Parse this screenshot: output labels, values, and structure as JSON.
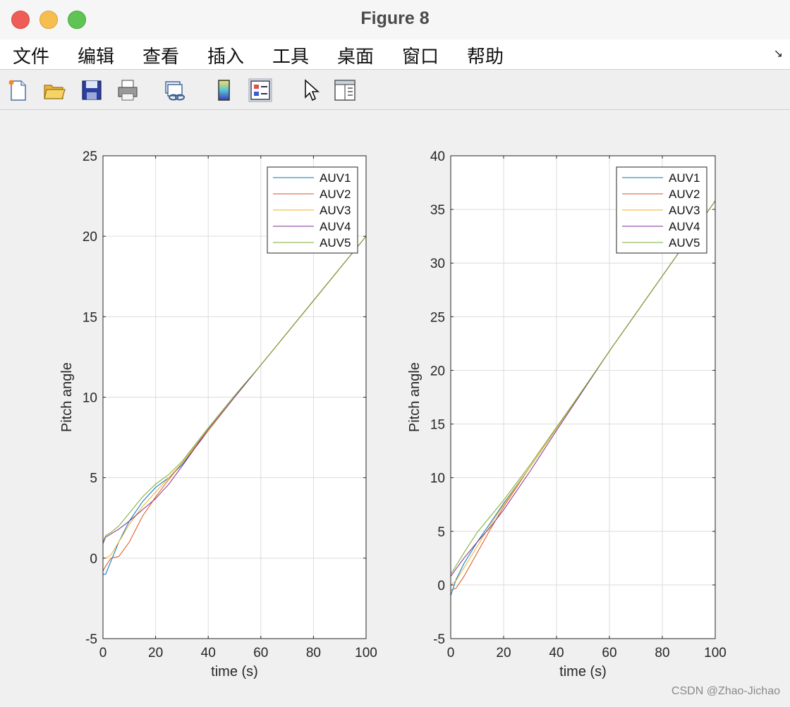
{
  "window": {
    "title": "Figure 8"
  },
  "menu": {
    "items": [
      "文件",
      "编辑",
      "查看",
      "插入",
      "工具",
      "桌面",
      "窗口",
      "帮助"
    ]
  },
  "toolbar": {
    "icons": [
      "new-figure-icon",
      "open-file-icon",
      "save-icon",
      "print-icon",
      "link-plot-icon",
      "colorbar-icon",
      "legend-icon",
      "pointer-icon",
      "property-editor-icon"
    ]
  },
  "watermark": "CSDN @Zhao-Jichao",
  "chart_data": [
    {
      "type": "line",
      "xlabel": "time (s)",
      "ylabel": "Pitch angle",
      "xlim": [
        0,
        100
      ],
      "ylim": [
        -5,
        25
      ],
      "xticks": [
        0,
        20,
        40,
        60,
        80,
        100
      ],
      "yticks": [
        -5,
        0,
        5,
        10,
        15,
        20,
        25
      ],
      "grid": true,
      "legend_position": "top-right",
      "series": [
        {
          "name": "AUV1",
          "color": "#0072bd",
          "x": [
            0,
            1,
            3,
            6,
            10,
            15,
            20,
            25,
            30,
            40,
            50,
            60,
            70,
            80,
            90,
            100
          ],
          "y": [
            -1,
            -1.0,
            -0.2,
            1.0,
            2.3,
            3.5,
            4.4,
            5.0,
            5.8,
            7.9,
            10.0,
            12.0,
            14.0,
            16.0,
            18.0,
            20.0
          ]
        },
        {
          "name": "AUV2",
          "color": "#d95319",
          "x": [
            0,
            1,
            3,
            6,
            10,
            15,
            20,
            25,
            30,
            40,
            50,
            60,
            70,
            80,
            90,
            100
          ],
          "y": [
            -0.8,
            -0.5,
            0,
            0.1,
            1.0,
            2.6,
            3.8,
            4.9,
            5.9,
            8.0,
            10.0,
            12.0,
            14.0,
            16.0,
            18.0,
            20.0
          ]
        },
        {
          "name": "AUV3",
          "color": "#edb120",
          "x": [
            0,
            1,
            3,
            6,
            10,
            15,
            20,
            25,
            30,
            40,
            50,
            60,
            70,
            80,
            90,
            100
          ],
          "y": [
            0,
            0,
            0.2,
            1.0,
            2.1,
            3.2,
            4.1,
            5.0,
            5.9,
            7.9,
            10.0,
            12.0,
            14.0,
            16.0,
            18.0,
            20.0
          ]
        },
        {
          "name": "AUV4",
          "color": "#7e2f8e",
          "x": [
            0,
            1,
            3,
            6,
            10,
            15,
            20,
            25,
            30,
            40,
            50,
            60,
            70,
            80,
            90,
            100
          ],
          "y": [
            0.9,
            1.3,
            1.5,
            1.8,
            2.3,
            3.0,
            3.7,
            4.6,
            5.7,
            8.0,
            10.0,
            12.0,
            14.0,
            16.0,
            18.0,
            20.0
          ]
        },
        {
          "name": "AUV5",
          "color": "#77ac30",
          "x": [
            0,
            1,
            3,
            6,
            10,
            15,
            20,
            25,
            30,
            40,
            50,
            60,
            70,
            80,
            90,
            100
          ],
          "y": [
            1.0,
            1.4,
            1.6,
            2.0,
            2.8,
            3.8,
            4.6,
            5.2,
            6.0,
            8.1,
            10.1,
            12.0,
            14.0,
            16.0,
            18.0,
            20.0
          ]
        }
      ]
    },
    {
      "type": "line",
      "xlabel": "time (s)",
      "ylabel": "Pitch angle",
      "xlim": [
        0,
        100
      ],
      "ylim": [
        -5,
        40
      ],
      "xticks": [
        0,
        20,
        40,
        60,
        80,
        100
      ],
      "yticks": [
        -5,
        0,
        5,
        10,
        15,
        20,
        25,
        30,
        35,
        40
      ],
      "grid": true,
      "legend_position": "top-right",
      "series": [
        {
          "name": "AUV1",
          "color": "#0072bd",
          "x": [
            0,
            2,
            5,
            10,
            15,
            20,
            30,
            40,
            50,
            60,
            70,
            80,
            90,
            100
          ],
          "y": [
            -1,
            0.5,
            2.0,
            4.0,
            5.8,
            7.6,
            11.0,
            14.6,
            18.2,
            21.8,
            25.3,
            28.8,
            32.3,
            35.8
          ]
        },
        {
          "name": "AUV2",
          "color": "#d95319",
          "x": [
            0,
            2,
            5,
            10,
            15,
            20,
            30,
            40,
            50,
            60,
            70,
            80,
            90,
            100
          ],
          "y": [
            -0.5,
            -0.3,
            0.8,
            3.0,
            5.2,
            7.3,
            11.0,
            14.6,
            18.2,
            21.8,
            25.3,
            28.8,
            32.3,
            35.8
          ]
        },
        {
          "name": "AUV3",
          "color": "#edb120",
          "x": [
            0,
            2,
            5,
            10,
            15,
            20,
            30,
            40,
            50,
            60,
            70,
            80,
            90,
            100
          ],
          "y": [
            0,
            0.4,
            1.6,
            3.6,
            5.6,
            7.5,
            11.0,
            14.6,
            18.2,
            21.8,
            25.3,
            28.8,
            32.3,
            35.8
          ]
        },
        {
          "name": "AUV4",
          "color": "#7e2f8e",
          "x": [
            0,
            2,
            5,
            10,
            15,
            20,
            30,
            40,
            50,
            60,
            70,
            80,
            90,
            100
          ],
          "y": [
            0.8,
            1.5,
            2.5,
            4.0,
            5.4,
            7.0,
            10.6,
            14.4,
            18.1,
            21.8,
            25.3,
            28.8,
            32.3,
            35.8
          ]
        },
        {
          "name": "AUV5",
          "color": "#77ac30",
          "x": [
            0,
            2,
            5,
            10,
            15,
            20,
            30,
            40,
            50,
            60,
            70,
            80,
            90,
            100
          ],
          "y": [
            1.0,
            1.8,
            3.0,
            4.9,
            6.4,
            7.9,
            11.2,
            14.7,
            18.2,
            21.8,
            25.3,
            28.8,
            32.3,
            35.8
          ]
        }
      ]
    }
  ]
}
